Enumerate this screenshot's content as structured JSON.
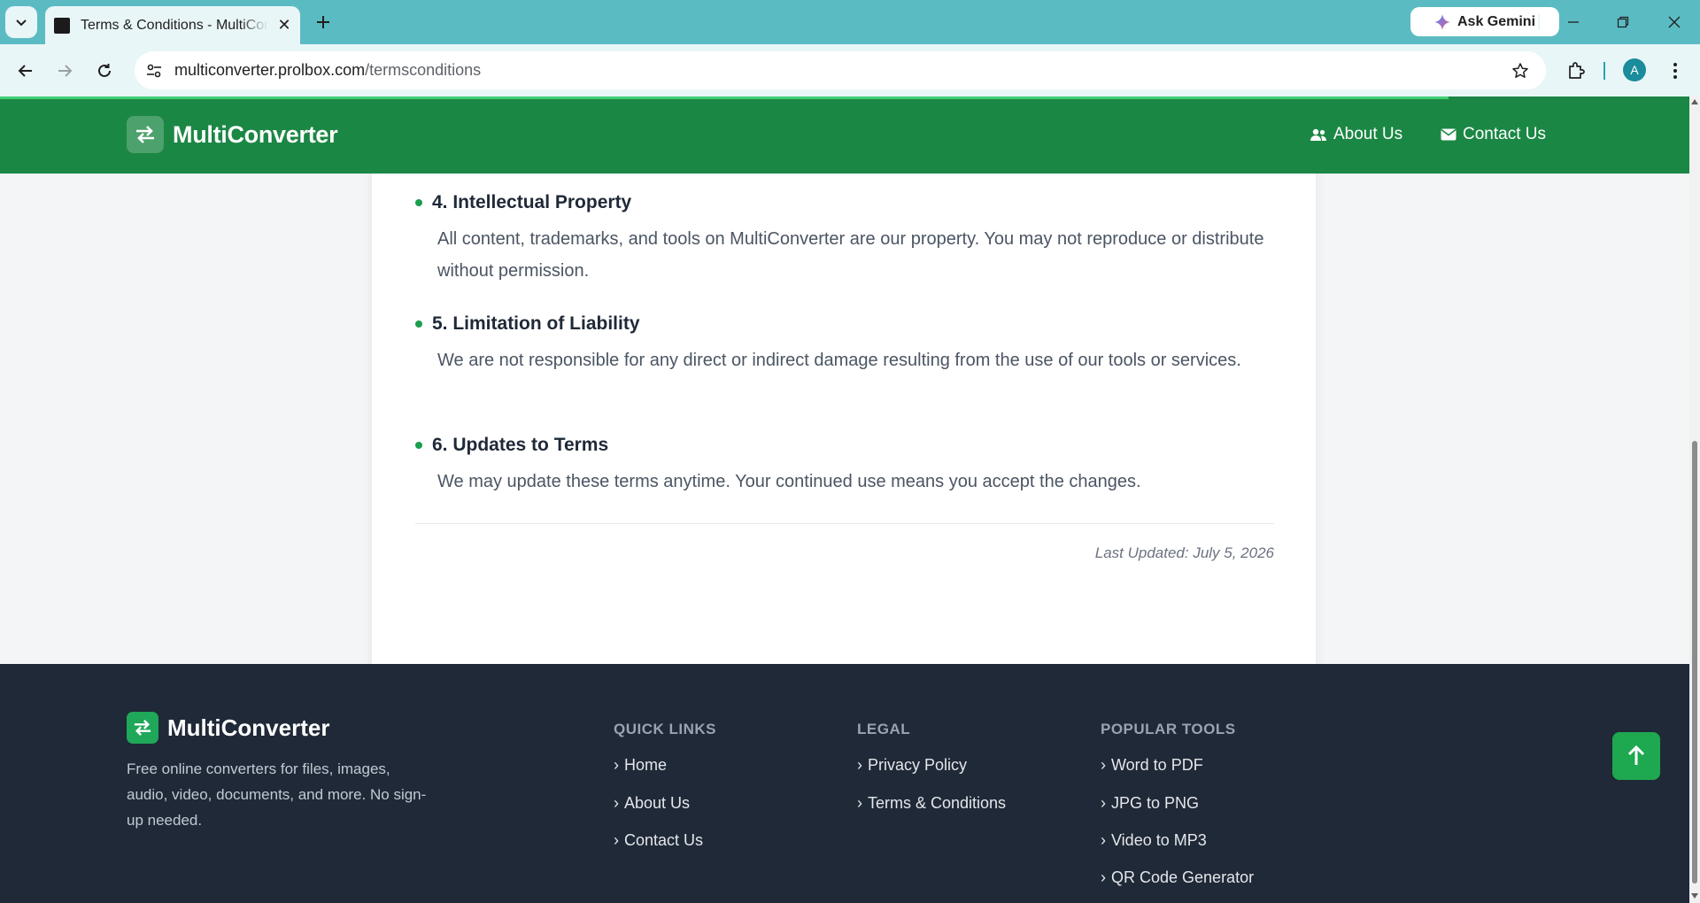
{
  "browser": {
    "tab_title": "Terms & Conditions - MultiConverter",
    "url_host": "multiconverter.prolbox.com",
    "url_path": "/termsconditions",
    "gemini_label": "Ask Gemini",
    "avatar_letter": "A"
  },
  "header": {
    "brand": "MultiConverter",
    "nav": [
      {
        "label": "About Us",
        "icon": "users-icon"
      },
      {
        "label": "Contact Us",
        "icon": "envelope-icon"
      }
    ]
  },
  "terms": {
    "sections": [
      {
        "title": "4. Intellectual Property",
        "body": "All content, trademarks, and tools on MultiConverter are our property. You may not reproduce or distribute without permission."
      },
      {
        "title": "5. Limitation of Liability",
        "body": "We are not responsible for any direct or indirect damage resulting from the use of our tools or services."
      },
      {
        "title": "6. Updates to Terms",
        "body": "We may update these terms anytime. Your continued use means you accept the changes."
      }
    ],
    "last_updated": "Last Updated: July 5, 2026"
  },
  "footer": {
    "brand": "MultiConverter",
    "description": "Free online converters for files, images, audio, video, documents, and more. No sign-up needed.",
    "columns": [
      {
        "heading": "QUICK LINKS",
        "links": [
          "Home",
          "About Us",
          "Contact Us"
        ]
      },
      {
        "heading": "LEGAL",
        "links": [
          "Privacy Policy",
          "Terms & Conditions"
        ]
      },
      {
        "heading": "POPULAR TOOLS",
        "links": [
          "Word to PDF",
          "JPG to PNG",
          "Video to MP3",
          "QR Code Generator"
        ]
      }
    ]
  },
  "colors": {
    "header_green": "#1b8744",
    "footer_dark": "#1f2937",
    "accent_green": "#1ea850",
    "chrome_teal": "#5bbbc3"
  }
}
